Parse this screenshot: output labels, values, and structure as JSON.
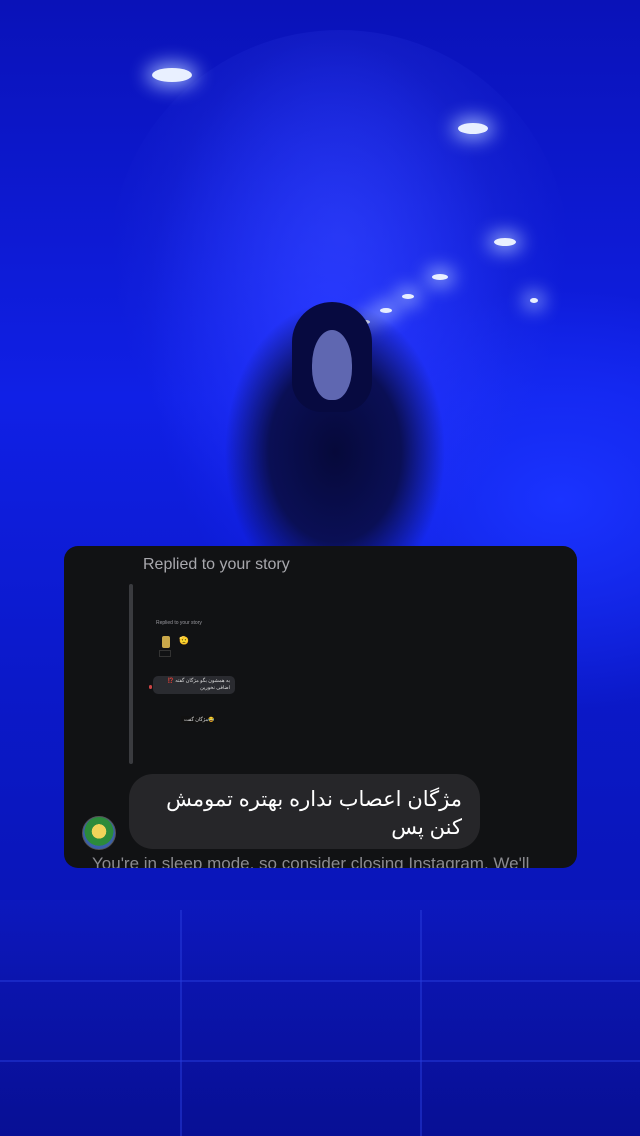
{
  "story": {
    "replied_label": "Replied to your story",
    "quoted": {
      "replied_label": "Replied to your story",
      "emoji": "🫡",
      "bubble_text": "به همشون بگو مژگان گفته ⁉️ اضافی نخورین",
      "reply_text": "مژگان گفت😂"
    },
    "message": "مژگان اعصاب نداره بهتره تمومش کنن پس",
    "sleep_notice": "You're in sleep mode, so consider closing Instagram. We'll"
  },
  "colors": {
    "background_blue": "#1020e6",
    "card": "#111214",
    "bubble": "#262629"
  }
}
